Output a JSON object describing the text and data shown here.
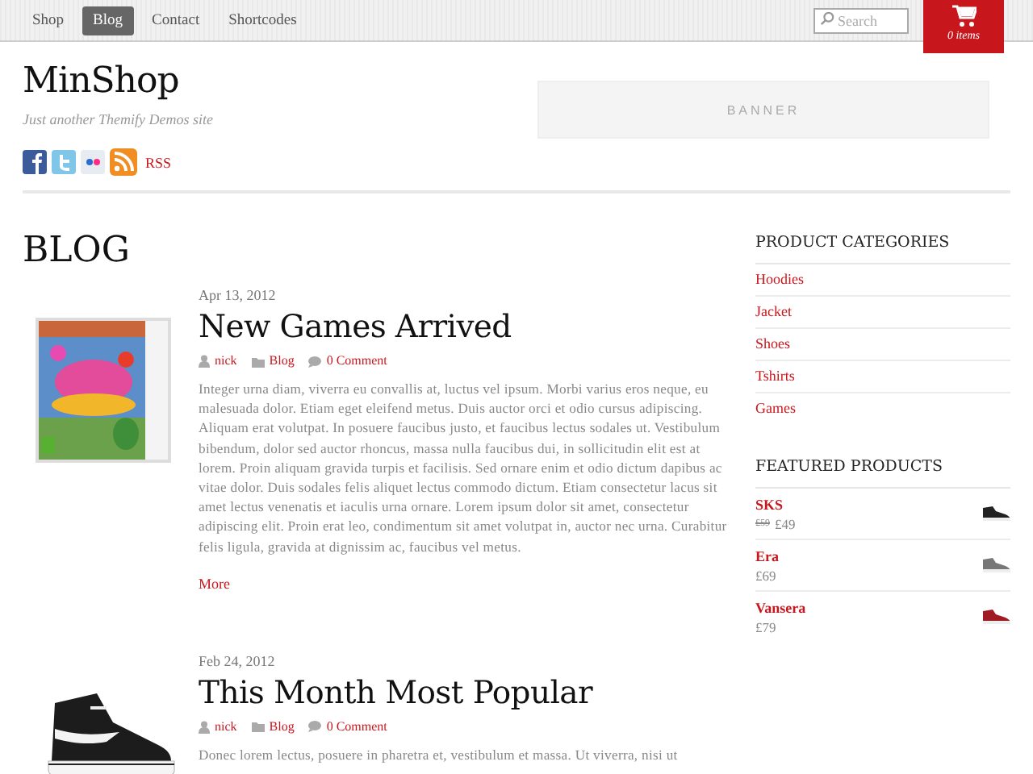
{
  "nav": [
    {
      "label": "Shop",
      "selected": false
    },
    {
      "label": "Blog",
      "selected": true
    },
    {
      "label": "Contact",
      "selected": false
    },
    {
      "label": "Shortcodes",
      "selected": false
    }
  ],
  "search": {
    "placeholder": "Search"
  },
  "cart": {
    "count": "0 items"
  },
  "site": {
    "title": "MinShop",
    "tagline": "Just another Themify Demos site"
  },
  "banner": "BANNER",
  "social": {
    "rss": "RSS"
  },
  "page_title": "BLOG",
  "posts": [
    {
      "date": "Apr 13, 2012",
      "title": "New Games Arrived",
      "author": "nick",
      "category": "Blog",
      "comments": "0 Comment",
      "body": "Integer urna diam, viverra eu convallis at, luctus vel ipsum. Morbi varius eros neque, eu malesuada dolor. Etiam eget eleifend metus. Duis auctor orci et odio cursus adipiscing. Aliquam erat volutpat. In posuere faucibus justo, et faucibus lectus sodales ut. Vestibulum bibendum, dolor sed auctor rhoncus, massa nulla faucibus dui, in sollicitudin elit est at lorem. Proin aliquam gravida turpis et facilisis. Sed ornare enim et odio dictum dapibus ac vitae dolor. Duis sodales felis aliquet lectus commodo dictum. Etiam consectetur lacus sit amet lectus venenatis et iaculis urna ornare. Lorem ipsum dolor sit amet, consectetur adipiscing elit. Proin erat leo, condimentum sit amet volutpat in, auctor nec urna. Curabitur felis ligula, gravida at dignissim ac, faucibus vel metus.",
      "more": "More"
    },
    {
      "date": "Feb 24, 2012",
      "title": "This Month Most Popular",
      "author": "nick",
      "category": "Blog",
      "comments": "0 Comment",
      "body": "Donec lorem lectus, posuere in pharetra et, vestibulum et massa. Ut viverra, nisi ut"
    }
  ],
  "sidebar": {
    "categories_title": "PRODUCT CATEGORIES",
    "categories": [
      "Hoodies",
      "Jacket",
      "Shoes",
      "Tshirts",
      "Games"
    ],
    "featured_title": "FEATURED PRODUCTS",
    "products": [
      {
        "name": "SKS",
        "old_price": "£59",
        "price": "£49",
        "color": "#222222"
      },
      {
        "name": "Era",
        "price": "£69",
        "color": "#777777"
      },
      {
        "name": "Vansera",
        "price": "£79",
        "color": "#a01a22"
      }
    ]
  }
}
